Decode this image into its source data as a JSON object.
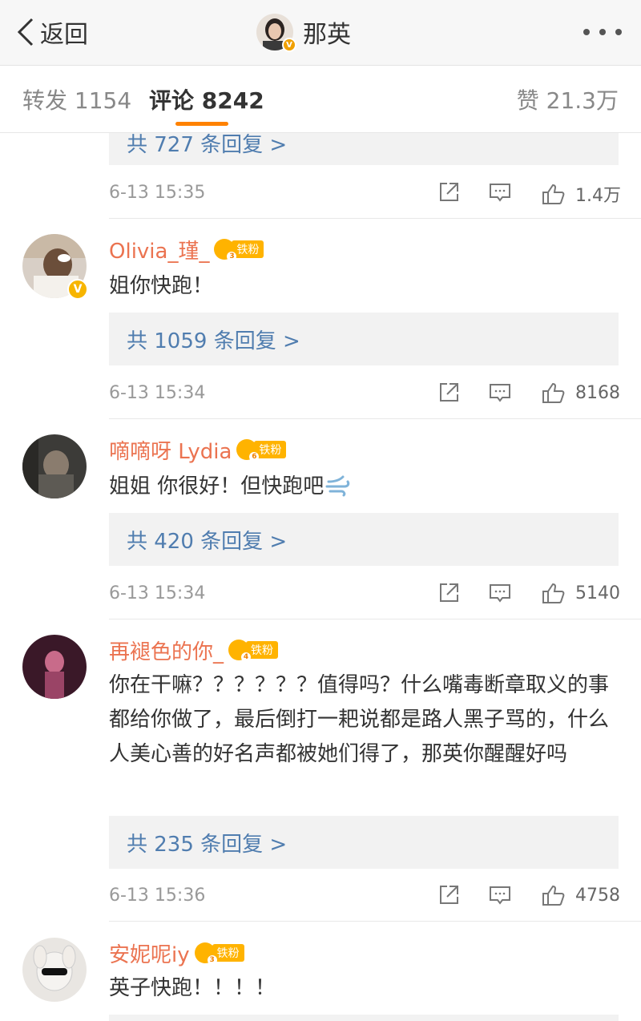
{
  "header": {
    "back_label": "返回",
    "author_name": "那英",
    "more_icon": "more-dots-icon"
  },
  "tabs": {
    "repost": "转发 1154",
    "comments": "评论 8242",
    "likes": "赞 21.3万"
  },
  "prev_comment": {
    "replies": "共 727 条回复 >",
    "time": "6-13 15:35",
    "likes": "1.4万"
  },
  "comments": [
    {
      "user": "Olivia_瑾_",
      "fan_level": "3",
      "fan_label": "铁粉",
      "verified": "V",
      "text": "姐你快跑！",
      "replies": "共 1059 条回复 >",
      "time": "6-13 15:34",
      "likes": "8168"
    },
    {
      "user": "嘀嘀呀 Lydia",
      "fan_level": "6",
      "fan_label": "铁粉",
      "text": "姐姐 你很好！但快跑吧",
      "replies": "共 420 条回复 >",
      "time": "6-13 15:34",
      "likes": "5140"
    },
    {
      "user": "再褪色的你_",
      "fan_level": "4",
      "fan_label": "铁粉",
      "text": "你在干嘛？？？？？？值得吗？什么嘴毒断章取义的事都给你做了，最后倒打一耙说都是路人黑子骂的，什么人美心善的好名声都被她们得了，那英你醒醒好吗",
      "replies": "共 235 条回复 >",
      "time": "6-13 15:36",
      "likes": "4758"
    },
    {
      "user": "安妮呢iy",
      "fan_level": "3",
      "fan_label": "铁粉",
      "text": "英子快跑！！！！"
    }
  ],
  "colors": {
    "accent": "#ff8200",
    "username": "#eb7350",
    "reply_link": "#507daf"
  }
}
